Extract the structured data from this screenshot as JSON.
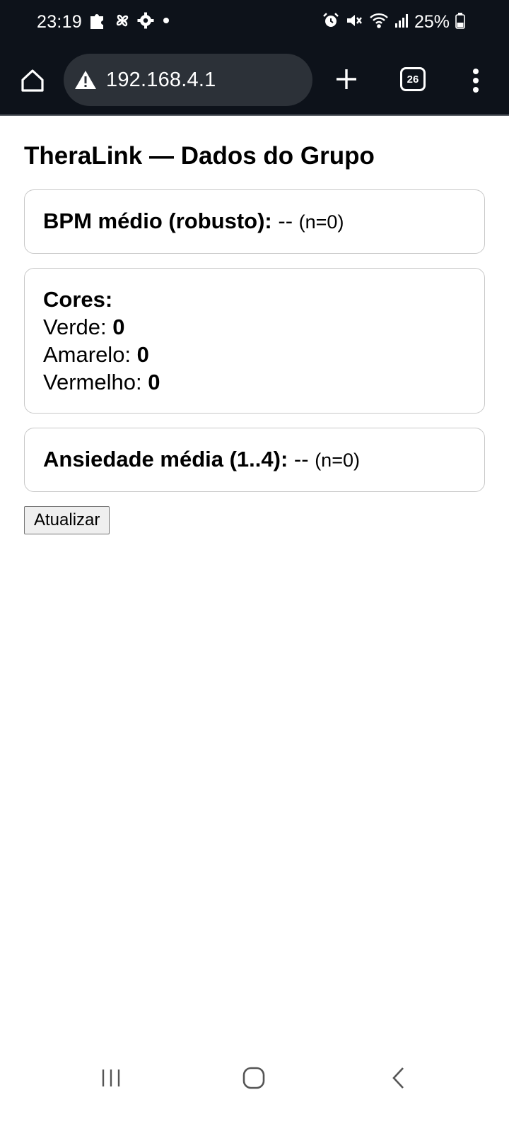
{
  "status_bar": {
    "time": "23:19",
    "battery": "25%",
    "left_icons": [
      "puzzle-icon",
      "pinwheel-icon",
      "settings-icon",
      "dot-icon"
    ],
    "right_icons": [
      "alarm-icon",
      "mute-icon",
      "wifi-icon",
      "signal-icon",
      "battery-icon"
    ]
  },
  "browser": {
    "url": "192.168.4.1",
    "tab_count": "26",
    "icons": [
      "home-icon",
      "warning-icon",
      "plus-icon",
      "tabs-icon",
      "more-vert-icon"
    ]
  },
  "page": {
    "title": "TheraLink — Dados do Grupo",
    "bpm": {
      "label": "BPM médio (robusto):",
      "value": "--",
      "count": "(n=0)"
    },
    "colors": {
      "heading": "Cores:",
      "green_label": "Verde:",
      "green_value": "0",
      "yellow_label": "Amarelo:",
      "yellow_value": "0",
      "red_label": "Vermelho:",
      "red_value": "0"
    },
    "anxiety": {
      "label": "Ansiedade média (1..4):",
      "value": "--",
      "count": "(n=0)"
    },
    "refresh_button": "Atualizar"
  },
  "nav_bar": {
    "icons": [
      "recents-icon",
      "home-nav-icon",
      "back-icon"
    ]
  },
  "colors": {
    "chrome_bg": "#0d121a",
    "urlbar_bg": "#2c3138",
    "card_border": "#c8c8c8"
  }
}
